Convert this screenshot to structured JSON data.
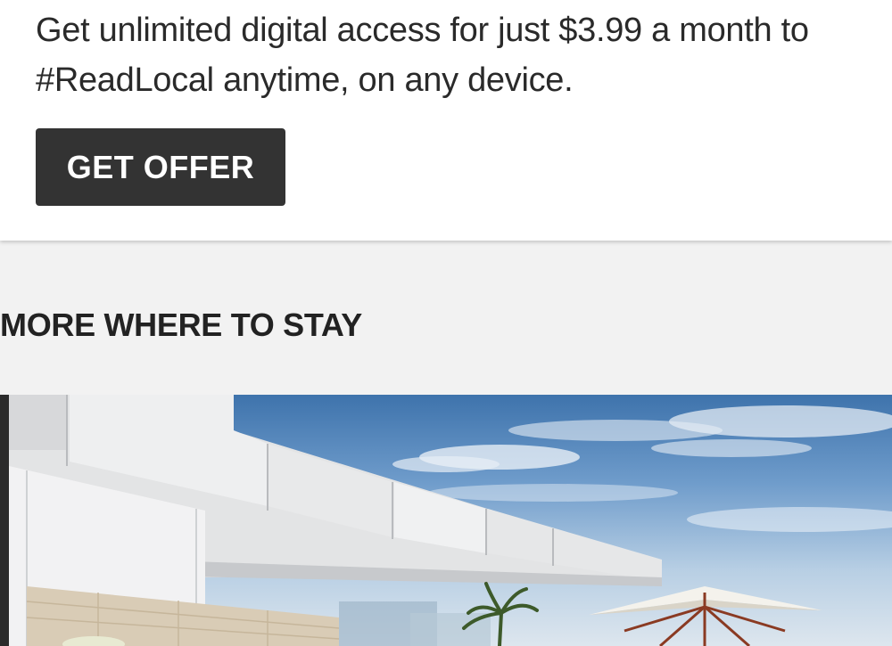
{
  "promo": {
    "text": "Get unlimited digital access for just $3.99 a month to #ReadLocal anytime, on any device.",
    "button_label": "GET OFFER"
  },
  "section": {
    "title": "MORE WHERE TO STAY"
  },
  "hero_image": {
    "icon": "hotel-rooftop-photo"
  },
  "colors": {
    "button_bg": "#333333",
    "page_bg": "#f2f2f2",
    "card_bg": "#ffffff"
  }
}
